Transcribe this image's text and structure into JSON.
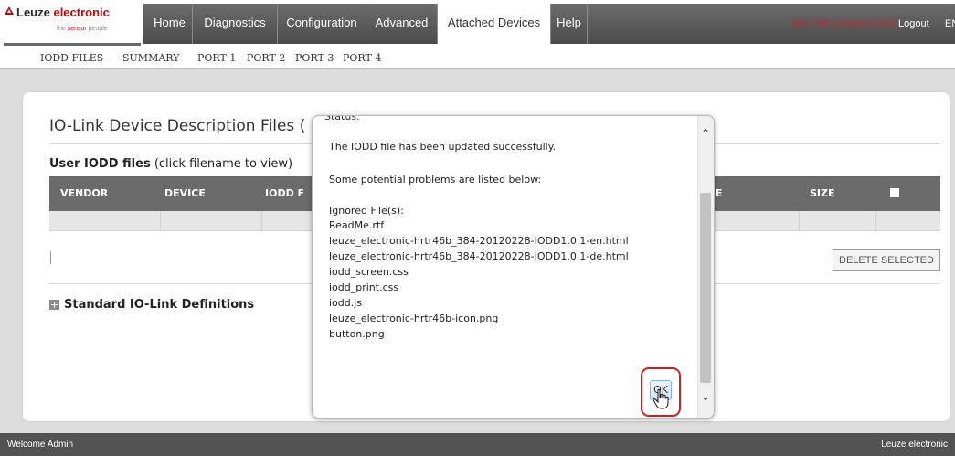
{
  "header": {
    "brand_prefix": "Leuze ",
    "brand_suffix": "electronic",
    "tagline_prefix": "the ",
    "tagline_highlight": "sensor",
    "tagline_suffix": " people",
    "tabs": [
      {
        "label": "Home"
      },
      {
        "label": "Diagnostics"
      },
      {
        "label": "Configuration"
      },
      {
        "label": "Advanced"
      },
      {
        "label": "Attached Devices",
        "active": true
      },
      {
        "label": "Help"
      }
    ],
    "status_text": "MD 748i 11/02/23 2022",
    "logout": "Logout",
    "language": "EN"
  },
  "subnav": {
    "items": [
      "IODD FILES",
      "SUMMARY",
      "PORT 1",
      "PORT 2",
      "PORT 3",
      "PORT 4"
    ]
  },
  "main": {
    "title": "IO-Link Device Description Files (",
    "user_files_bold": "User IODD files",
    "user_files_hint": " (click filename to view)",
    "columns": [
      "VENDOR",
      "DEVICE",
      "IODD F",
      "E",
      "SIZE"
    ],
    "delete_selected": "DELETE SELECTED",
    "standard_defs": "Standard IO-Link Definitions"
  },
  "modal": {
    "cut_header": "Status:",
    "message": "The IODD file has been updated successfully.",
    "problems_intro": "Some potential problems are listed below:",
    "ignored_label": "Ignored File(s):",
    "ignored_files": [
      "ReadMe.rtf",
      "leuze_electronic-hrtr46b_384-20120228-IODD1.0.1-en.html",
      "leuze_electronic-hrtr46b_384-20120228-IODD1.0.1-de.html",
      "iodd_screen.css",
      "iodd_print.css",
      "iodd.js",
      "leuze_electronic-hrtr46b-icon.png",
      "button.png"
    ],
    "ok_label": "OK"
  },
  "footer": {
    "left": "Welcome Admin",
    "right": "Leuze electronic"
  },
  "colors": {
    "nav_bg": "#5a5a5a",
    "brand_red": "#d00000",
    "highlight_red": "#cc2020"
  }
}
